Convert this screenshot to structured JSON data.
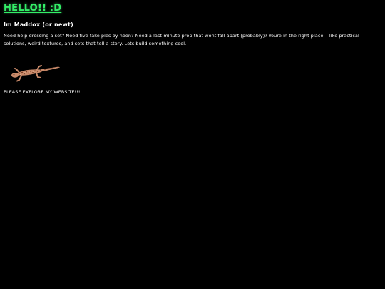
{
  "header": {
    "title": "HELLO!! :D",
    "subtitle": "Im Maddox (or newt)"
  },
  "intro": {
    "text": "Need help dressing a set? Need five fake pies by noon? Need a last-minute prop that wont fall apart (probably)? Youre in the right place. I like practical solutions, weird textures, and sets that tell a story. Lets build something cool."
  },
  "image": {
    "icon": "gecko-icon"
  },
  "footer": {
    "explore_text": "PLEASE EXPLORE MY WEBSITE!!!"
  },
  "colors": {
    "background": "#000000",
    "title": "#33ee66",
    "text": "#ffffff",
    "gecko": "#c98a6a"
  }
}
